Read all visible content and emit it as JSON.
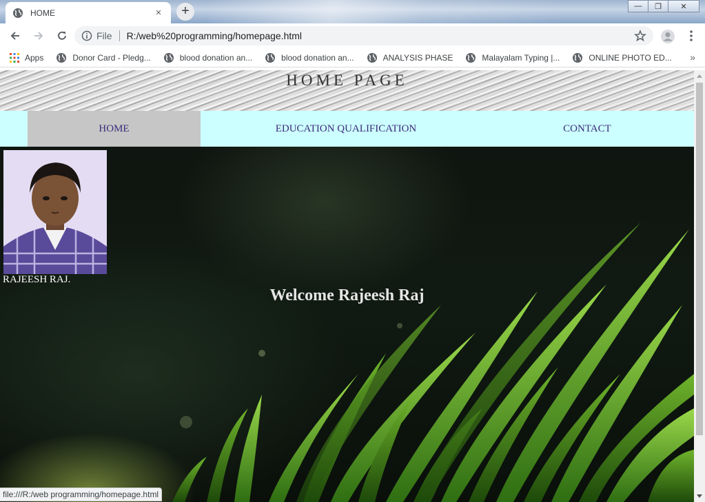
{
  "browser": {
    "tab": {
      "title": "HOME",
      "close": "×"
    },
    "new_tab": "+",
    "window_controls": {
      "minimize": "—",
      "maximize": "❐",
      "close": "✕"
    },
    "address": {
      "scheme_label": "File",
      "url": "R:/web%20programming/homepage.html"
    },
    "bookmarks": [
      {
        "label": "Apps",
        "icon": "apps-grid-icon"
      },
      {
        "label": "Donor Card - Pledg...",
        "icon": "globe-icon"
      },
      {
        "label": "blood donation an...",
        "icon": "globe-icon"
      },
      {
        "label": "blood donation an...",
        "icon": "globe-icon"
      },
      {
        "label": "ANALYSIS PHASE",
        "icon": "globe-icon"
      },
      {
        "label": "Malayalam Typing |...",
        "icon": "globe-icon"
      },
      {
        "label": "ONLINE PHOTO ED...",
        "icon": "globe-icon"
      }
    ],
    "bookmarks_more": "»",
    "status_url": "file:///R:/web programming/homepage.html"
  },
  "page": {
    "header_title": "HOME PAGE",
    "nav": [
      {
        "label": "HOME",
        "active": true
      },
      {
        "label": "EDUCATION QUALIFICATION",
        "active": false
      },
      {
        "label": "CONTACT",
        "active": false
      }
    ],
    "profile_name": "RAJEESH RAJ.",
    "welcome": "Welcome Rajeesh Raj"
  },
  "colors": {
    "nav_bg": "#ccffff",
    "nav_active_bg": "#c6c6c6",
    "nav_text": "#3a2a7a",
    "content_bg": "#0f1510",
    "grass": "#5aa028"
  }
}
